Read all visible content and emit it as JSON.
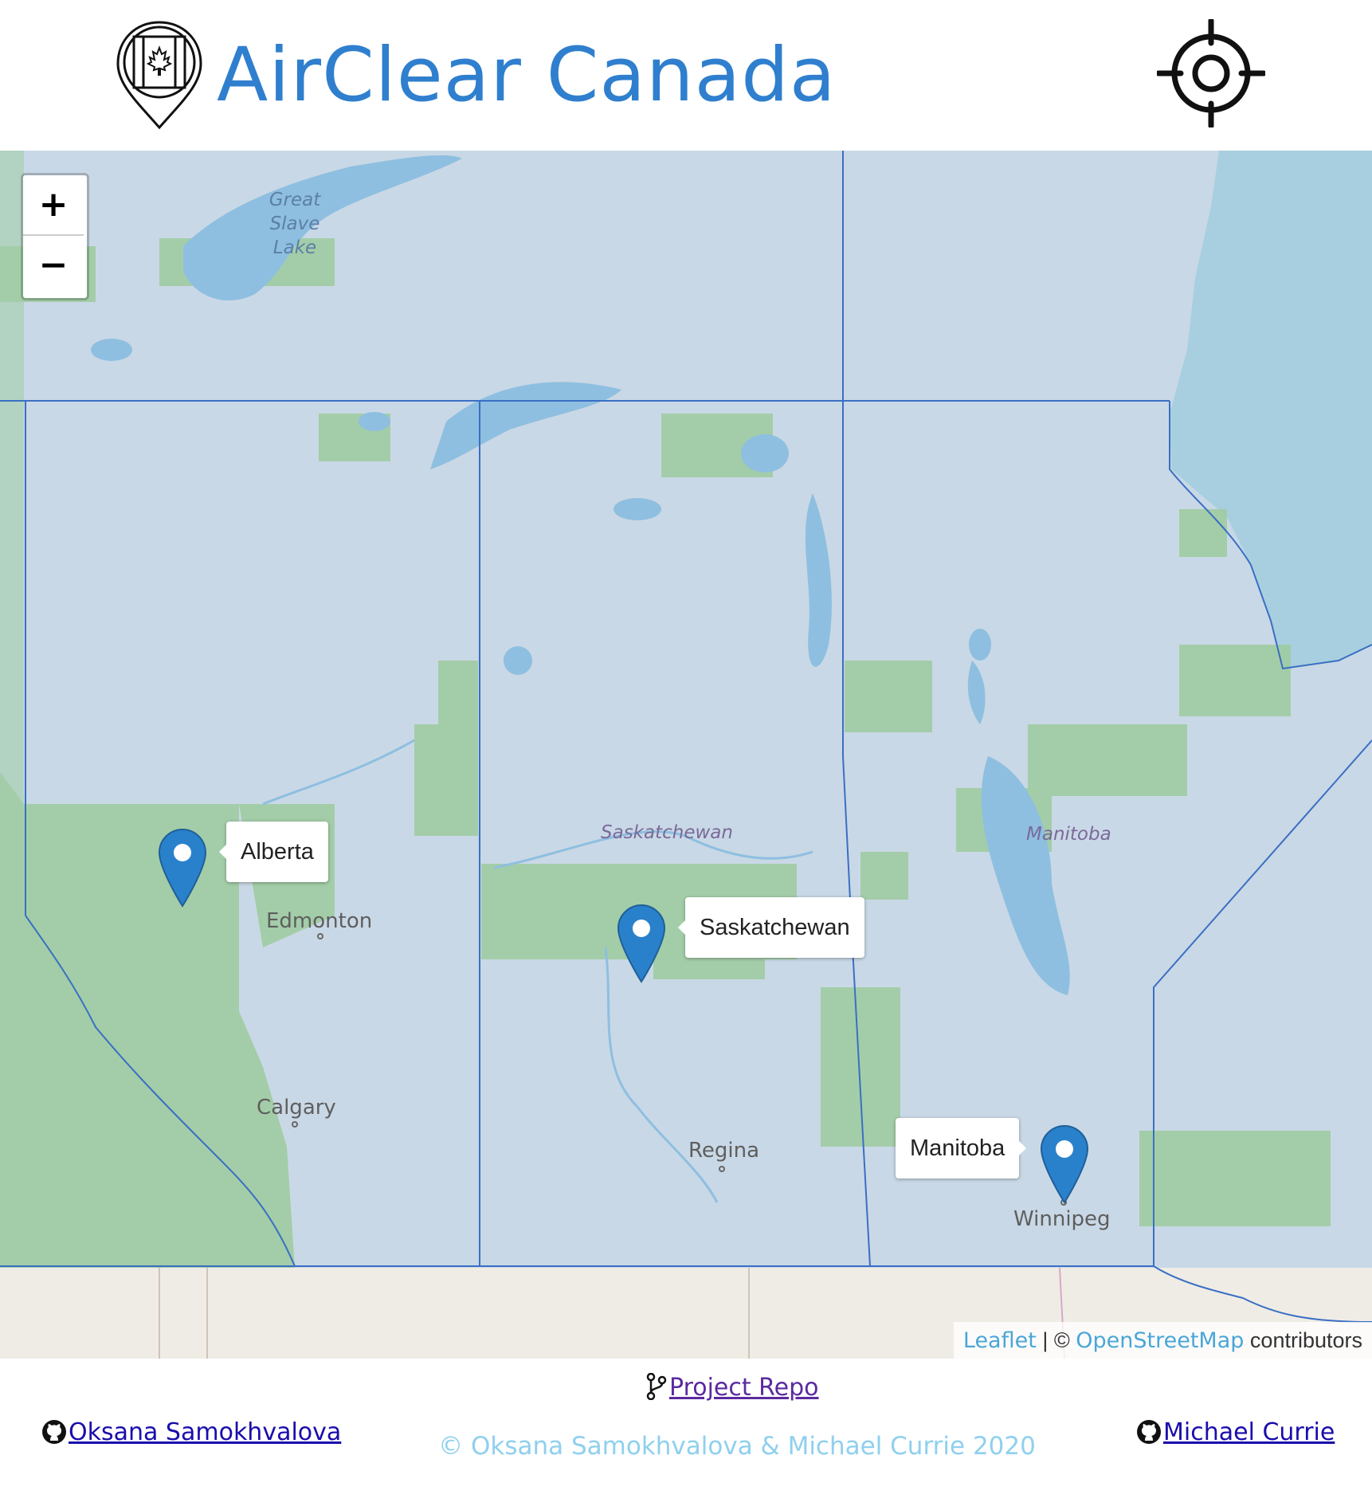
{
  "header": {
    "title": "AirClear Canada",
    "logo_icon": "canada-flag-map-pin-icon",
    "locate_icon": "crosshair-target-icon"
  },
  "map": {
    "zoom_in_label": "+",
    "zoom_out_label": "−",
    "markers": [
      {
        "label": "Alberta",
        "icon": "map-marker-icon"
      },
      {
        "label": "Saskatchewan",
        "icon": "map-marker-icon"
      },
      {
        "label": "Manitoba",
        "icon": "map-marker-icon"
      }
    ],
    "labels": {
      "lake": "Great Slave Lake",
      "lake_line1": "Great",
      "lake_line2": "Slave",
      "lake_line3": "Lake",
      "prov_sask": "Saskatchewan",
      "prov_man": "Manitoba",
      "city_edmonton": "Edmonton",
      "city_calgary": "Calgary",
      "city_regina": "Regina",
      "city_winnipeg": "Winnipeg"
    },
    "attribution": {
      "leaflet": "Leaflet",
      "separator": "| ©",
      "osm": "OpenStreetMap",
      "suffix": "contributors"
    },
    "colors": {
      "overlay": "#c9d8e6",
      "forest": "#9ccb9e",
      "water": "#8ebfe0",
      "border": "#3a6fc4",
      "marker": "#2a81cb"
    }
  },
  "footer": {
    "repo_label": "Project Repo",
    "author1": "Oksana Samokhvalova",
    "author2": "Michael Currie",
    "copyright": "© Oksana Samokhvalova & Michael Currie 2020"
  }
}
